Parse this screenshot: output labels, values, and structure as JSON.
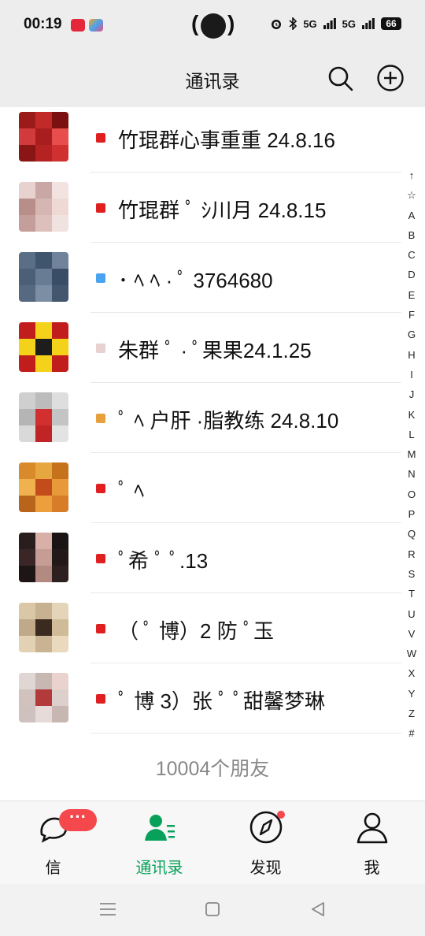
{
  "status_bar": {
    "time": "00:19",
    "network_labels": [
      "5G",
      "5G"
    ],
    "battery": "66"
  },
  "nav": {
    "title": "通讯录"
  },
  "contacts": [
    {
      "label": "竹琨群心事重重 24.8.16",
      "avatar_colors": [
        "#9b1b1b",
        "#c22a2a",
        "#7a1010",
        "#d23b3b",
        "#a81d1d",
        "#e84d4d",
        "#8a1515",
        "#b52222",
        "#d13030"
      ]
    },
    {
      "label": "竹琨群  ﾟ  ｼ川月  24.8.15",
      "avatar_colors": [
        "#e8d2cf",
        "#c9a7a4",
        "#f2e3e0",
        "#b88e8a",
        "#d6b6b2",
        "#eed9d5",
        "#c39e9a",
        "#ddc0bb",
        "#efe2df"
      ]
    },
    {
      "label": "  ･ ﾍ  ﾍ  ·  ﾟ  3764680",
      "avatar_colors": [
        "#5a6e86",
        "#3f546d",
        "#70839a",
        "#4b5f77",
        "#687c94",
        "#394d66",
        "#556980",
        "#7b8ea3",
        "#42566e"
      ]
    },
    {
      "label": "  朱群 ﾟ ·  ﾟ果果24.1.25",
      "avatar_colors": [
        "#c21d1d",
        "#f5d21a",
        "#c21d1d",
        "#f5d21a",
        "#1d1d1d",
        "#f5d21a",
        "#c21d1d",
        "#f5d21a",
        "#c21d1d"
      ]
    },
    {
      "label": "ﾟ ﾍ  户肝  ·脂教练 24.8.10",
      "avatar_colors": [
        "#cfcfcf",
        "#bcbcbc",
        "#dedede",
        "#b5b5b5",
        "#d23030",
        "#c4c4c4",
        "#d9d9d9",
        "#c02424",
        "#e3e3e3"
      ]
    },
    {
      "label": " ﾟ ﾍ",
      "avatar_colors": [
        "#d98a2a",
        "#e6a640",
        "#c5721a",
        "#f0b24e",
        "#c24d1a",
        "#e89a3a",
        "#b8641a",
        "#ec9f3c",
        "#d77d28"
      ]
    },
    {
      "label": " ﾟ希  ﾟ  ﾟ.13",
      "avatar_colors": [
        "#2a1d1d",
        "#d8b0a8",
        "#1a1414",
        "#3a2626",
        "#c59d94",
        "#241919",
        "#1e1616",
        "#b38a82",
        "#2f2020"
      ]
    },
    {
      "label": "（ ﾟ  博）2 防 ﾟ玉",
      "avatar_colors": [
        "#d9c7a6",
        "#c7b190",
        "#e5d5b8",
        "#bfa988",
        "#3a2a20",
        "#d0bb98",
        "#e2d1b2",
        "#c9b392",
        "#ead9bc"
      ]
    },
    {
      "label": " ﾟ 博 3）张  ﾟ  ﾟ甜馨梦琳",
      "avatar_colors": [
        "#e0d6d3",
        "#c8b8b4",
        "#ead3cf",
        "#d2c2be",
        "#b33a3a",
        "#ddd0cc",
        "#cfc1bd",
        "#e6dbd8",
        "#c7b6b2"
      ]
    }
  ],
  "index_letters": [
    "↑",
    "☆",
    "A",
    "B",
    "C",
    "D",
    "E",
    "F",
    "G",
    "H",
    "I",
    "J",
    "K",
    "L",
    "M",
    "N",
    "O",
    "P",
    "Q",
    "R",
    "S",
    "T",
    "U",
    "V",
    "W",
    "X",
    "Y",
    "Z",
    "#"
  ],
  "footer": {
    "count": "10004个朋友"
  },
  "tabs": [
    {
      "label": "信",
      "icon": "chat-icon",
      "badge": "···"
    },
    {
      "label": "通讯录",
      "icon": "contacts-icon"
    },
    {
      "label": "发现",
      "icon": "compass-icon"
    },
    {
      "label": "我",
      "icon": "person-icon"
    }
  ],
  "colors": {
    "accent": "#07a15a",
    "badge": "#f5484d",
    "background": "#ededed"
  }
}
